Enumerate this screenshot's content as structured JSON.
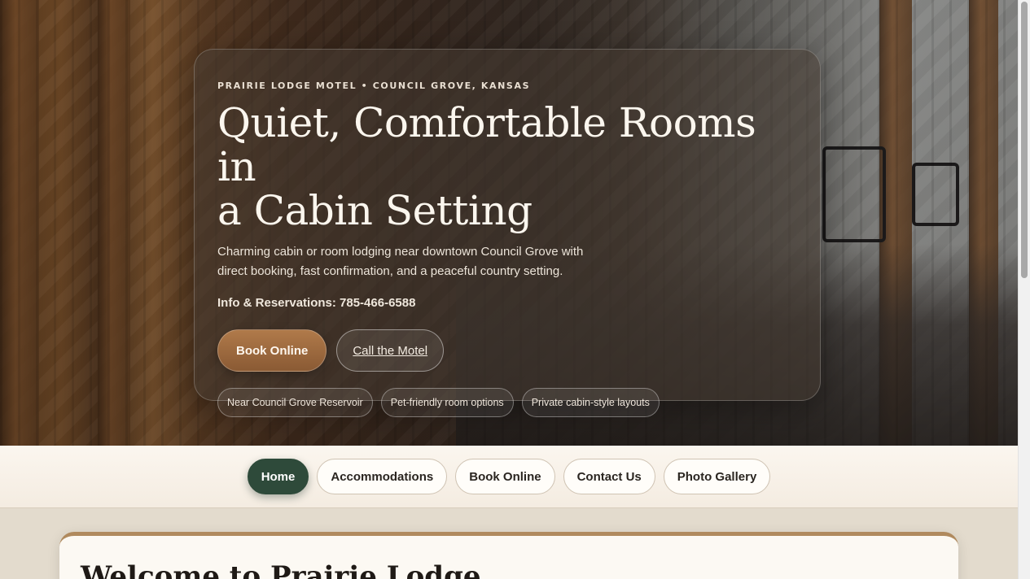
{
  "hero": {
    "eyebrow": "PRAIRIE LODGE MOTEL • COUNCIL GROVE, KANSAS",
    "title_line1": "Quiet, Comfortable Rooms in",
    "title_line2": "a Cabin Setting",
    "description": "Charming cabin or room lodging near downtown Council Grove with direct booking, fast confirmation, and a peaceful country setting.",
    "phone_text": "Info & Reservations: 785-466-6588",
    "primary_button": "Book Online",
    "secondary_button": "Call the Motel",
    "chips": [
      "Near Council Grove Reservoir",
      "Pet-friendly room options",
      "Private cabin-style layouts"
    ]
  },
  "nav": {
    "items": [
      {
        "label": "Home",
        "active": true
      },
      {
        "label": "Accommodations",
        "active": false
      },
      {
        "label": "Book Online",
        "active": false
      },
      {
        "label": "Contact Us",
        "active": false
      },
      {
        "label": "Photo Gallery",
        "active": false
      }
    ]
  },
  "content": {
    "welcome_title": "Welcome to Prairie Lodge"
  },
  "colors": {
    "accent_green": "#2e4a3a",
    "accent_brown": "#9a6a40",
    "page_background": "#e3dbcd"
  }
}
